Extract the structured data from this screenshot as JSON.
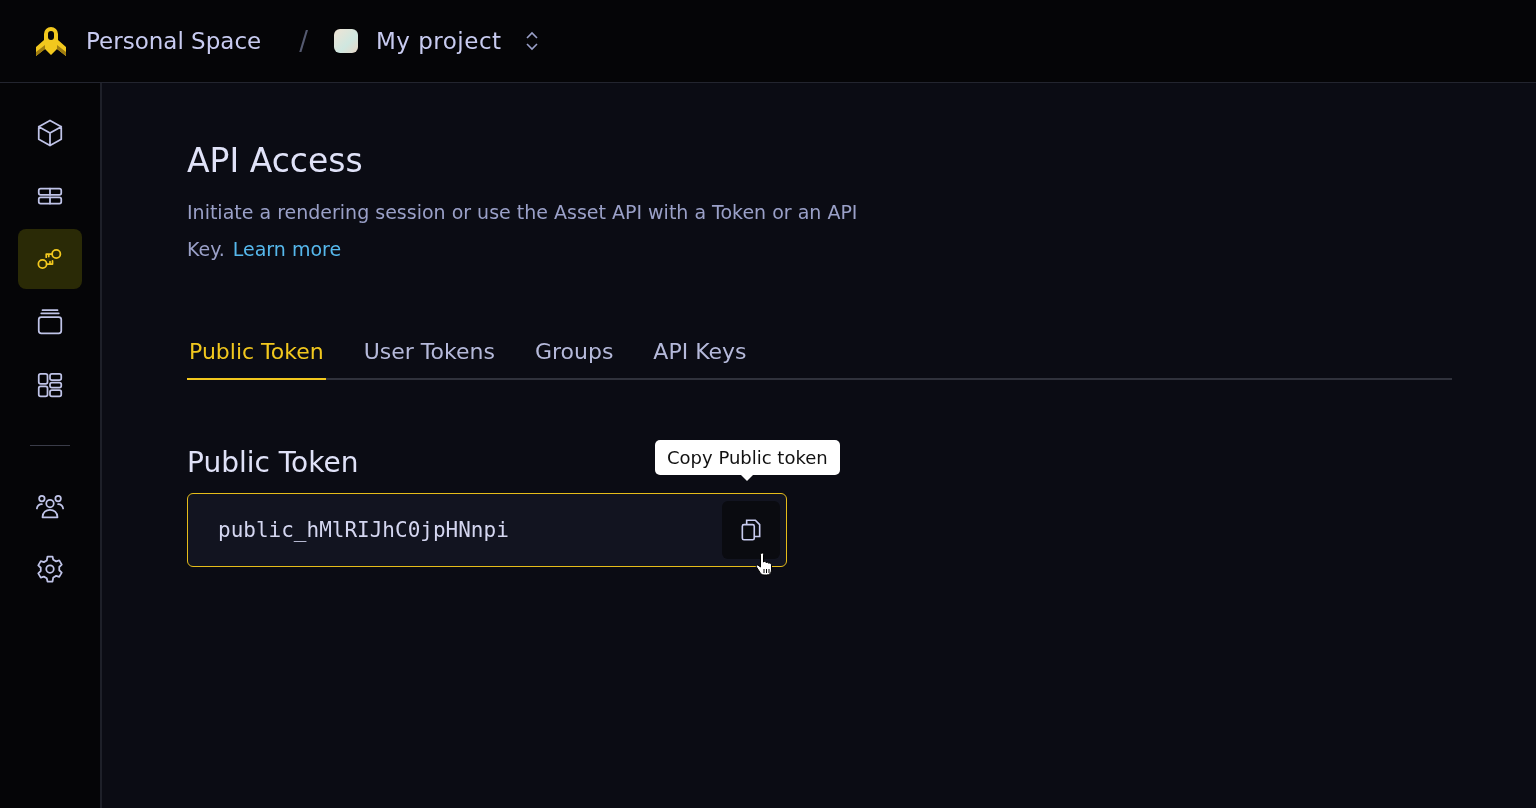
{
  "header": {
    "workspace": "Personal Space",
    "separator": "/",
    "project": "My project"
  },
  "sidebar": {
    "top_items": [
      {
        "kind": "cube",
        "selected": false
      },
      {
        "kind": "table",
        "selected": false
      },
      {
        "kind": "keys",
        "selected": true
      },
      {
        "kind": "stack",
        "selected": false
      },
      {
        "kind": "grid",
        "selected": false
      }
    ],
    "bottom_items": [
      {
        "kind": "people",
        "selected": false
      },
      {
        "kind": "settings",
        "selected": false
      }
    ]
  },
  "page": {
    "title": "API Access",
    "description": "Initiate a rendering session or use the Asset API with a Token or an API Key.",
    "link": "Learn more"
  },
  "tabs": [
    {
      "label": "Public Token",
      "selected": true
    },
    {
      "label": "User Tokens",
      "selected": false
    },
    {
      "label": "Groups",
      "selected": false
    },
    {
      "label": "API Keys",
      "selected": false
    }
  ],
  "section": {
    "title": "Public Token",
    "token": "public_hMlRIJhC0jpHNnpi",
    "tooltip": "Copy Public token"
  }
}
